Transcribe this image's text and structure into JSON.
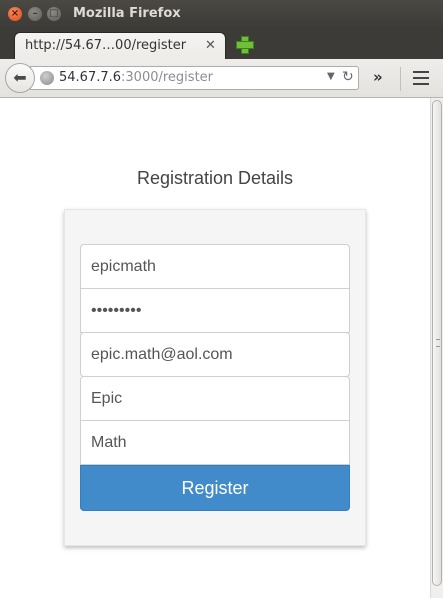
{
  "window": {
    "title": "Mozilla Firefox"
  },
  "tab": {
    "title": "http://54.67…00/register",
    "close_glyph": "✕"
  },
  "nav": {
    "url_host": "54.67.7.6",
    "url_rest": ":3000/register"
  },
  "page": {
    "heading": "Registration Details",
    "fields": {
      "username": "epicmath",
      "password": "epicmath!",
      "email": "epic.math@aol.com",
      "first_name": "Epic",
      "last_name": "Math"
    },
    "register_label": "Register"
  },
  "colors": {
    "primary": "#428bca",
    "accent_close": "#df4b16"
  },
  "icons": [
    "close-window-icon",
    "minimize-icon",
    "maximize-icon",
    "new-tab-plus-icon",
    "back-arrow-icon",
    "globe-icon",
    "dropdown-arrow-icon",
    "reload-icon",
    "overflow-chevron-icon",
    "hamburger-menu-icon"
  ]
}
